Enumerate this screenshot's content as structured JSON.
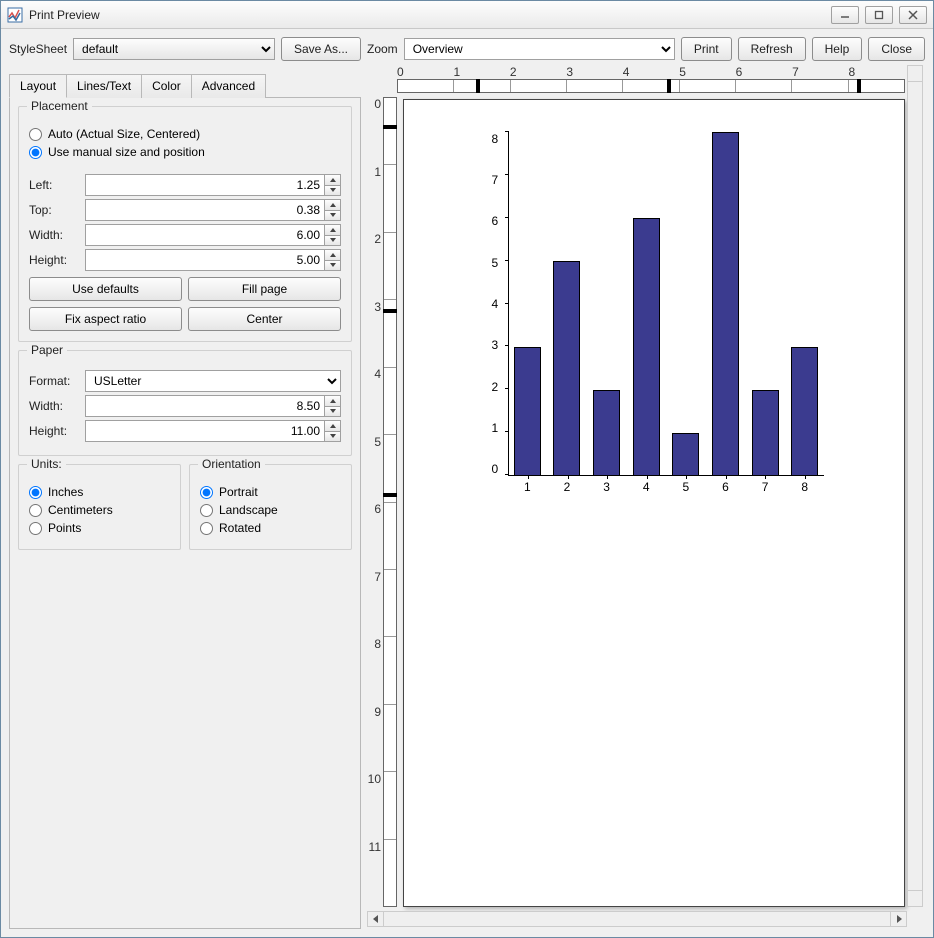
{
  "window": {
    "title": "Print Preview"
  },
  "toolbar_left": {
    "stylesheet_label": "StyleSheet",
    "stylesheet_value": "default",
    "save_as": "Save As..."
  },
  "tabs": {
    "layout": "Layout",
    "lines": "Lines/Text",
    "color": "Color",
    "advanced": "Advanced"
  },
  "placement": {
    "title": "Placement",
    "auto": "Auto (Actual Size, Centered)",
    "manual": "Use manual size and position",
    "selected": "manual",
    "left_label": "Left:",
    "left": "1.25",
    "top_label": "Top:",
    "top": "0.38",
    "width_label": "Width:",
    "width": "6.00",
    "height_label": "Height:",
    "height": "5.00",
    "use_defaults": "Use defaults",
    "fill_page": "Fill page",
    "fix_aspect": "Fix aspect ratio",
    "center": "Center"
  },
  "paper": {
    "title": "Paper",
    "format_label": "Format:",
    "format": "USLetter",
    "width_label": "Width:",
    "width": "8.50",
    "height_label": "Height:",
    "height": "11.00"
  },
  "units": {
    "title": "Units:",
    "inches": "Inches",
    "centimeters": "Centimeters",
    "points": "Points",
    "selected": "inches"
  },
  "orientation": {
    "title": "Orientation",
    "portrait": "Portrait",
    "landscape": "Landscape",
    "rotated": "Rotated",
    "selected": "portrait"
  },
  "toolbar_right": {
    "zoom_label": "Zoom",
    "zoom_value": "Overview",
    "print": "Print",
    "refresh": "Refresh",
    "help": "Help",
    "close": "Close"
  },
  "hruler": {
    "labels": [
      "0",
      "1",
      "2",
      "3",
      "4",
      "5",
      "6",
      "7",
      "8"
    ],
    "markers_in": [
      1.25,
      4.25,
      7.25
    ]
  },
  "vruler": {
    "labels": [
      "0",
      "1",
      "2",
      "3",
      "4",
      "5",
      "6",
      "7",
      "8",
      "9",
      "10",
      "11"
    ],
    "markers_in": [
      0.38,
      2.88,
      5.38
    ]
  },
  "page": {
    "width_in": 8.5,
    "height_in": 11.0,
    "fig_left_in": 1.25,
    "fig_top_in": 0.38,
    "fig_w_in": 6.0,
    "fig_h_in": 5.0
  },
  "chart_data": {
    "type": "bar",
    "categories": [
      "1",
      "2",
      "3",
      "4",
      "5",
      "6",
      "7",
      "8"
    ],
    "values": [
      3,
      5,
      2,
      6,
      1,
      8,
      2,
      3
    ],
    "title": "",
    "xlabel": "",
    "ylabel": "",
    "ylim": [
      0,
      8
    ],
    "yticks": [
      0,
      1,
      2,
      3,
      4,
      5,
      6,
      7,
      8
    ],
    "bar_color": "#3b3b8f"
  }
}
